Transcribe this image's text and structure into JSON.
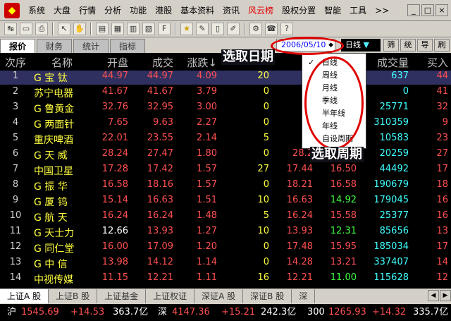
{
  "menu": {
    "items": [
      "系统",
      "大盘",
      "行情",
      "分析",
      "功能",
      "港股",
      "基本资料",
      "资讯",
      "风云榜",
      "股权分置",
      "智能",
      "工具",
      ">>"
    ],
    "active_index": 8
  },
  "window_controls": [
    "_",
    "□",
    "×"
  ],
  "tabs": [
    "报价",
    "财务",
    "统计",
    "指标"
  ],
  "date_selector": {
    "value": "2006/05/10"
  },
  "period_selector": {
    "value": "日线",
    "arrow": "▼"
  },
  "side_buttons": [
    "筛",
    "统",
    "导",
    "刷"
  ],
  "columns": {
    "idx": "次序",
    "name": "名称",
    "open": "开盘",
    "close": "成交",
    "chg": "涨跌↓",
    "high": "高",
    "vol": "成交量",
    "buy": "买入"
  },
  "rows": [
    {
      "idx": "1",
      "name": "G 宝  钛",
      "open": "44.97",
      "close": "44.97",
      "chg": "4.09",
      "x": "20",
      "high": "44",
      "low": "",
      "vol": "637",
      "buy": "44",
      "selected": true
    },
    {
      "idx": "2",
      "name": "苏宁电器",
      "open": "41.67",
      "close": "41.67",
      "chg": "3.79",
      "x": "0",
      "high": "41",
      "low": "",
      "vol": "0",
      "buy": "41"
    },
    {
      "idx": "3",
      "name": "G 鲁黄金",
      "open": "32.76",
      "close": "32.95",
      "chg": "3.00",
      "x": "0",
      "high": "32",
      "low": "",
      "vol": "25771",
      "buy": "32"
    },
    {
      "idx": "4",
      "name": "G 两面针",
      "open": "7.65",
      "close": "9.63",
      "chg": "2.27",
      "x": "0",
      "high": "9",
      "low": "",
      "vol": "310359",
      "buy": "9"
    },
    {
      "idx": "5",
      "name": "重庆啤酒",
      "open": "22.01",
      "close": "23.55",
      "chg": "2.14",
      "x": "5",
      "high": "23",
      "low": "",
      "vol": "10583",
      "buy": "23"
    },
    {
      "idx": "6",
      "name": "G 天  威",
      "open": "28.24",
      "close": "27.47",
      "chg": "1.80",
      "x": "0",
      "high": "28.2",
      "low": "",
      "vol": "20259",
      "buy": "27"
    },
    {
      "idx": "7",
      "name": "中国卫星",
      "open": "17.28",
      "close": "17.42",
      "chg": "1.57",
      "x": "27",
      "high": "17.44",
      "low": "16.50",
      "vol": "44492",
      "buy": "17"
    },
    {
      "idx": "8",
      "name": "G 振  华",
      "open": "16.58",
      "close": "18.16",
      "chg": "1.57",
      "x": "0",
      "high": "18.21",
      "low": "16.58",
      "vol": "190679",
      "buy": "18"
    },
    {
      "idx": "9",
      "name": "G 厦  钨",
      "open": "15.14",
      "close": "16.63",
      "chg": "1.51",
      "x": "10",
      "high": "16.63",
      "low": "14.92",
      "vol": "179045",
      "buy": "16"
    },
    {
      "idx": "10",
      "name": "G 航  天",
      "open": "16.24",
      "close": "16.24",
      "chg": "1.48",
      "x": "5",
      "high": "16.24",
      "low": "15.58",
      "vol": "25377",
      "buy": "16"
    },
    {
      "idx": "11",
      "name": "G 天士力",
      "open": "12.66",
      "close": "13.93",
      "chg": "1.27",
      "x": "10",
      "high": "13.93",
      "low": "12.31",
      "vol": "85656",
      "buy": "13"
    },
    {
      "idx": "12",
      "name": "G 同仁堂",
      "open": "16.00",
      "close": "17.09",
      "chg": "1.20",
      "x": "0",
      "high": "17.48",
      "low": "15.95",
      "vol": "185034",
      "buy": "17"
    },
    {
      "idx": "13",
      "name": "G 中  信",
      "open": "13.98",
      "close": "14.12",
      "chg": "1.14",
      "x": "0",
      "high": "14.28",
      "low": "13.21",
      "vol": "337407",
      "buy": "14"
    },
    {
      "idx": "14",
      "name": "中视传媒",
      "open": "11.15",
      "close": "12.21",
      "chg": "1.11",
      "x": "16",
      "high": "12.21",
      "low": "11.00",
      "vol": "115628",
      "buy": "12"
    }
  ],
  "dropdown": {
    "options": [
      "日线",
      "周线",
      "月线",
      "季线",
      "半年线",
      "年线",
      "自设周期"
    ],
    "checked_index": 0,
    "check_mark": "✓"
  },
  "annotations": {
    "date": "选取日期",
    "period": "选取周期"
  },
  "bottom_tabs": [
    "上证A 股",
    "上证B 股",
    "上证基金",
    "上证权证",
    "深证A 股",
    "深证B 股",
    "深"
  ],
  "status": {
    "sh_label": "沪",
    "sh_index": "1545.69",
    "sh_change": "+14.53",
    "sh_amount": "363.7亿",
    "sz_label": "深",
    "sz_index": "4147.36",
    "sz_change": "+15.21",
    "sz_amount": "242.3亿",
    "hs_label": "300",
    "hs_index": "1265.93",
    "hs_change": "+14.32",
    "hs_amount": "335.7亿"
  },
  "colors": {
    "up": "#ff5050",
    "name": "#ffff40",
    "volume": "#40ffff",
    "annotation_oval": "#e00000",
    "selected_row": "#303060"
  }
}
